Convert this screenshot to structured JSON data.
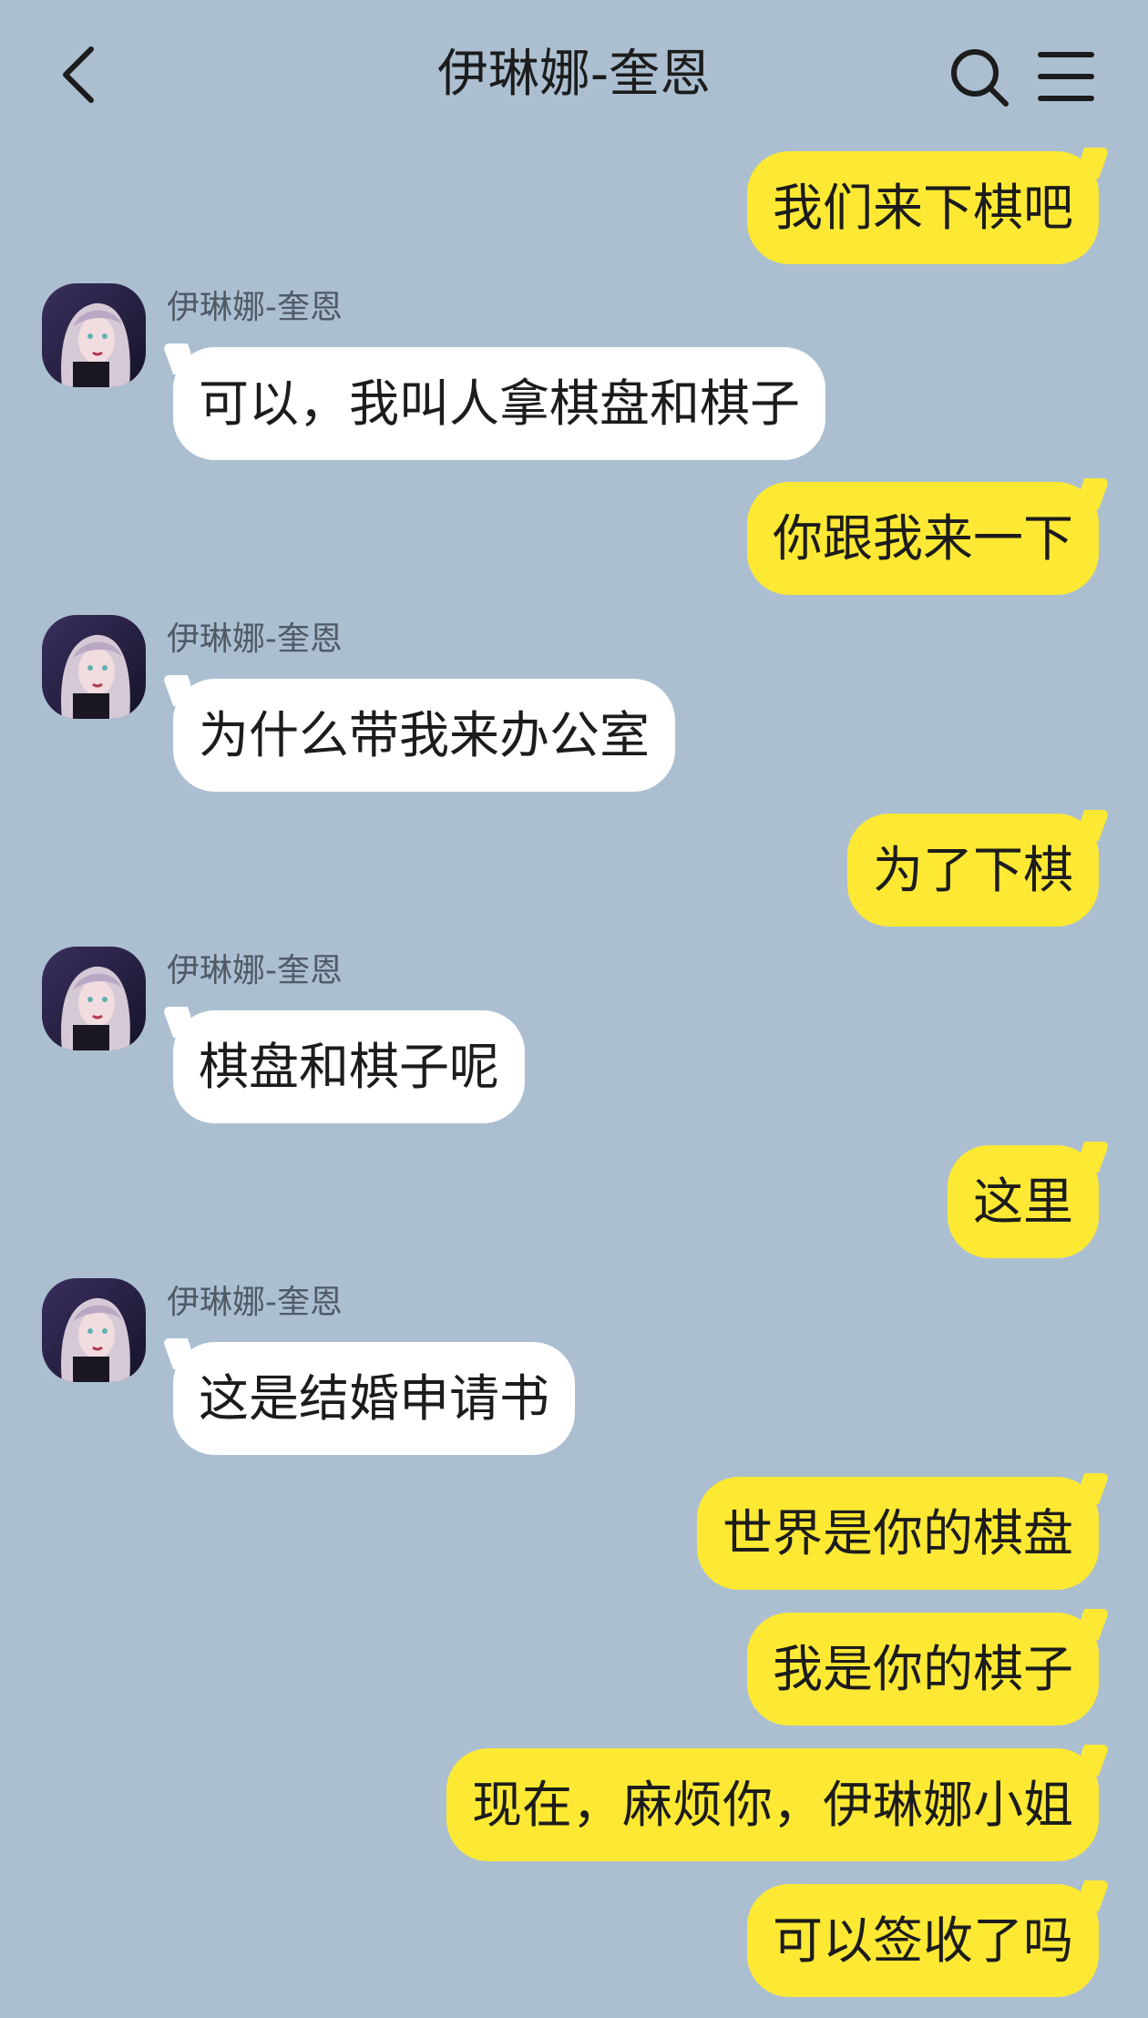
{
  "header": {
    "title": "伊琳娜-奎恩"
  },
  "icons": {
    "back": "chevron-left-icon",
    "search": "search-icon",
    "menu": "hamburger-menu-icon"
  },
  "colors": {
    "background": "#abbfd1",
    "outgoing_bubble": "#fde933",
    "incoming_bubble": "#ffffff"
  },
  "messages": [
    {
      "side": "out",
      "text": "我们来下棋吧"
    },
    {
      "side": "in",
      "sender": "伊琳娜-奎恩",
      "text": "可以，我叫人拿棋盘和棋子"
    },
    {
      "side": "out",
      "text": "你跟我来一下"
    },
    {
      "side": "in",
      "sender": "伊琳娜-奎恩",
      "text": "为什么带我来办公室"
    },
    {
      "side": "out",
      "text": "为了下棋"
    },
    {
      "side": "in",
      "sender": "伊琳娜-奎恩",
      "text": "棋盘和棋子呢"
    },
    {
      "side": "out",
      "text": "这里"
    },
    {
      "side": "in",
      "sender": "伊琳娜-奎恩",
      "text": "这是结婚申请书"
    },
    {
      "side": "out",
      "text": "世界是你的棋盘"
    },
    {
      "side": "out",
      "text": "我是你的棋子"
    },
    {
      "side": "out",
      "text": "现在，麻烦你，伊琳娜小姐"
    },
    {
      "side": "out",
      "text": "可以签收了吗"
    }
  ]
}
